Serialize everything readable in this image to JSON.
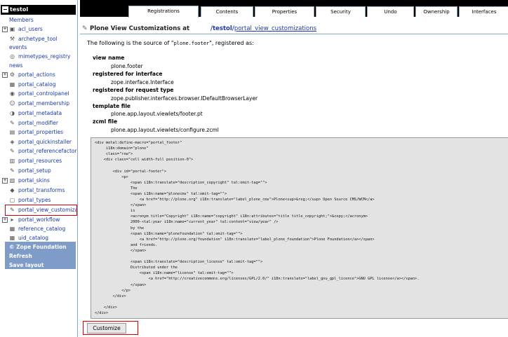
{
  "tree": {
    "root_label": "testol",
    "items": [
      {
        "label": "Members",
        "icon": "",
        "exp": ""
      },
      {
        "label": "acl_users",
        "icon": "folder-icon",
        "exp": "+"
      },
      {
        "label": "archetype_tool",
        "icon": "tool-icon",
        "exp": ""
      },
      {
        "label": "events",
        "icon": "",
        "exp": ""
      },
      {
        "label": "mimetypes_registry",
        "icon": "registry-icon",
        "exp": ""
      },
      {
        "label": "news",
        "icon": "",
        "exp": ""
      },
      {
        "label": "portal_actions",
        "icon": "gear-icon",
        "exp": "+"
      },
      {
        "label": "portal_catalog",
        "icon": "catalog-icon",
        "exp": ""
      },
      {
        "label": "portal_controlpanel",
        "icon": "controlpanel-icon",
        "exp": ""
      },
      {
        "label": "portal_membership",
        "icon": "membership-icon",
        "exp": ""
      },
      {
        "label": "portal_metadata",
        "icon": "metadata-icon",
        "exp": ""
      },
      {
        "label": "portal_modifier",
        "icon": "pencil-icon",
        "exp": ""
      },
      {
        "label": "portal_properties",
        "icon": "properties-icon",
        "exp": ""
      },
      {
        "label": "portal_quickinstaller",
        "icon": "installer-icon",
        "exp": ""
      },
      {
        "label": "portal_referencefactoris",
        "icon": "reference-icon",
        "exp": ""
      },
      {
        "label": "portal_resources",
        "icon": "resources-icon",
        "exp": ""
      },
      {
        "label": "portal_setup",
        "icon": "setup-icon",
        "exp": ""
      },
      {
        "label": "portal_skins",
        "icon": "skins-icon",
        "exp": "+"
      },
      {
        "label": "portal_transforms",
        "icon": "transforms-icon",
        "exp": ""
      },
      {
        "label": "portal_types",
        "icon": "types-icon",
        "exp": ""
      },
      {
        "label": "portal_view_customiza",
        "icon": "pencil-icon",
        "exp": ""
      },
      {
        "label": "portal_workflow",
        "icon": "workflow-icon",
        "exp": "+"
      },
      {
        "label": "reference_catalog",
        "icon": "catalog-icon",
        "exp": ""
      },
      {
        "label": "uid_catalog",
        "icon": "catalog-icon",
        "exp": ""
      }
    ],
    "footer_links": [
      "© Zope Foundation",
      "Refresh",
      "Save layout"
    ]
  },
  "tabs": [
    "Registrations",
    "Contents",
    "Properties",
    "Security",
    "Undo",
    "Ownership",
    "Interfaces"
  ],
  "active_tab": "Registrations",
  "heading": {
    "title": "Plone View Customizations at",
    "path_root": "/testol/",
    "path_link": "portal_view_customizations"
  },
  "intro": {
    "prefix": "The following is the source of \"",
    "name": "plone.footer",
    "suffix": "\", registered as:"
  },
  "details": [
    {
      "term": "view name",
      "value": "plone.footer"
    },
    {
      "term": "registered for interface",
      "value": "zope.interface.Interface"
    },
    {
      "term": "registered for request type",
      "value": "zope.publisher.interfaces.browser.IDefaultBrowserLayer"
    },
    {
      "term": "template file",
      "value": "plone.app.layout.viewlets/footer.pt"
    },
    {
      "term": "zcml file",
      "value": "plone.app.layout.viewlets/configure.zcml"
    }
  ],
  "code_lines": [
    "<div metal:define-macro=\"portal_footer\"",
    "     i18n:domain=\"plone\"",
    "     class=\"row\">",
    "    <div class=\"cell width-full position-0\">",
    "",
    "        <div id=\"portal-footer\">",
    "            <p>",
    "                <span i18n:translate=\"description_copyright\" tal:omit-tag=\"\">",
    "                The",
    "                <span i18n:name=\"plonecms\" tal:omit-tag=\"\">",
    "                    <a href=\"http://plone.org\" i18n:translate=\"label_plone_cms\">Plone<sup>&reg;</sup> Open Source CMS/WCM</a>",
    "                </span>",
    "                is",
    "                <acronym title=\"Copyright\" i18n:name=\"copyright\" i18n:attributes=\"title title_copyright;\">&copy;</acronym>",
    "                2000-<tal:year i18n:name=\"current_year\" tal:content=\"view/year\" />",
    "                by the",
    "                <span i18n:name=\"plonefoundation\" tal:omit-tag=\"\">",
    "                    <a href=\"http://plone.org/foundation\" i18n:translate=\"label_plone_foundation\">Plone Foundation</a></span>",
    "                and friends.",
    "                </span>",
    "",
    "                <span i18n:translate=\"description_license\" tal:omit-tag=\"\">",
    "                Distributed under the",
    "                    <span i18n:name=\"license\" tal:omit-tag=\"\">",
    "                        <a href=\"http://creativecommons.org/licenses/GPL/2.0/\" i18n:translate=\"label_gnu_gpl_licence\">GNU GPL license</a></span>.",
    "                </span>",
    "            </p>",
    "        </div>",
    "",
    "    </div>",
    "</div>"
  ],
  "customize_label": "Customize",
  "colors": {
    "tree_link": "#1a3aa6",
    "blue_panel": "#7f9bc8",
    "highlight_border": "#dd0000",
    "code_bg": "#e3e3e3"
  }
}
